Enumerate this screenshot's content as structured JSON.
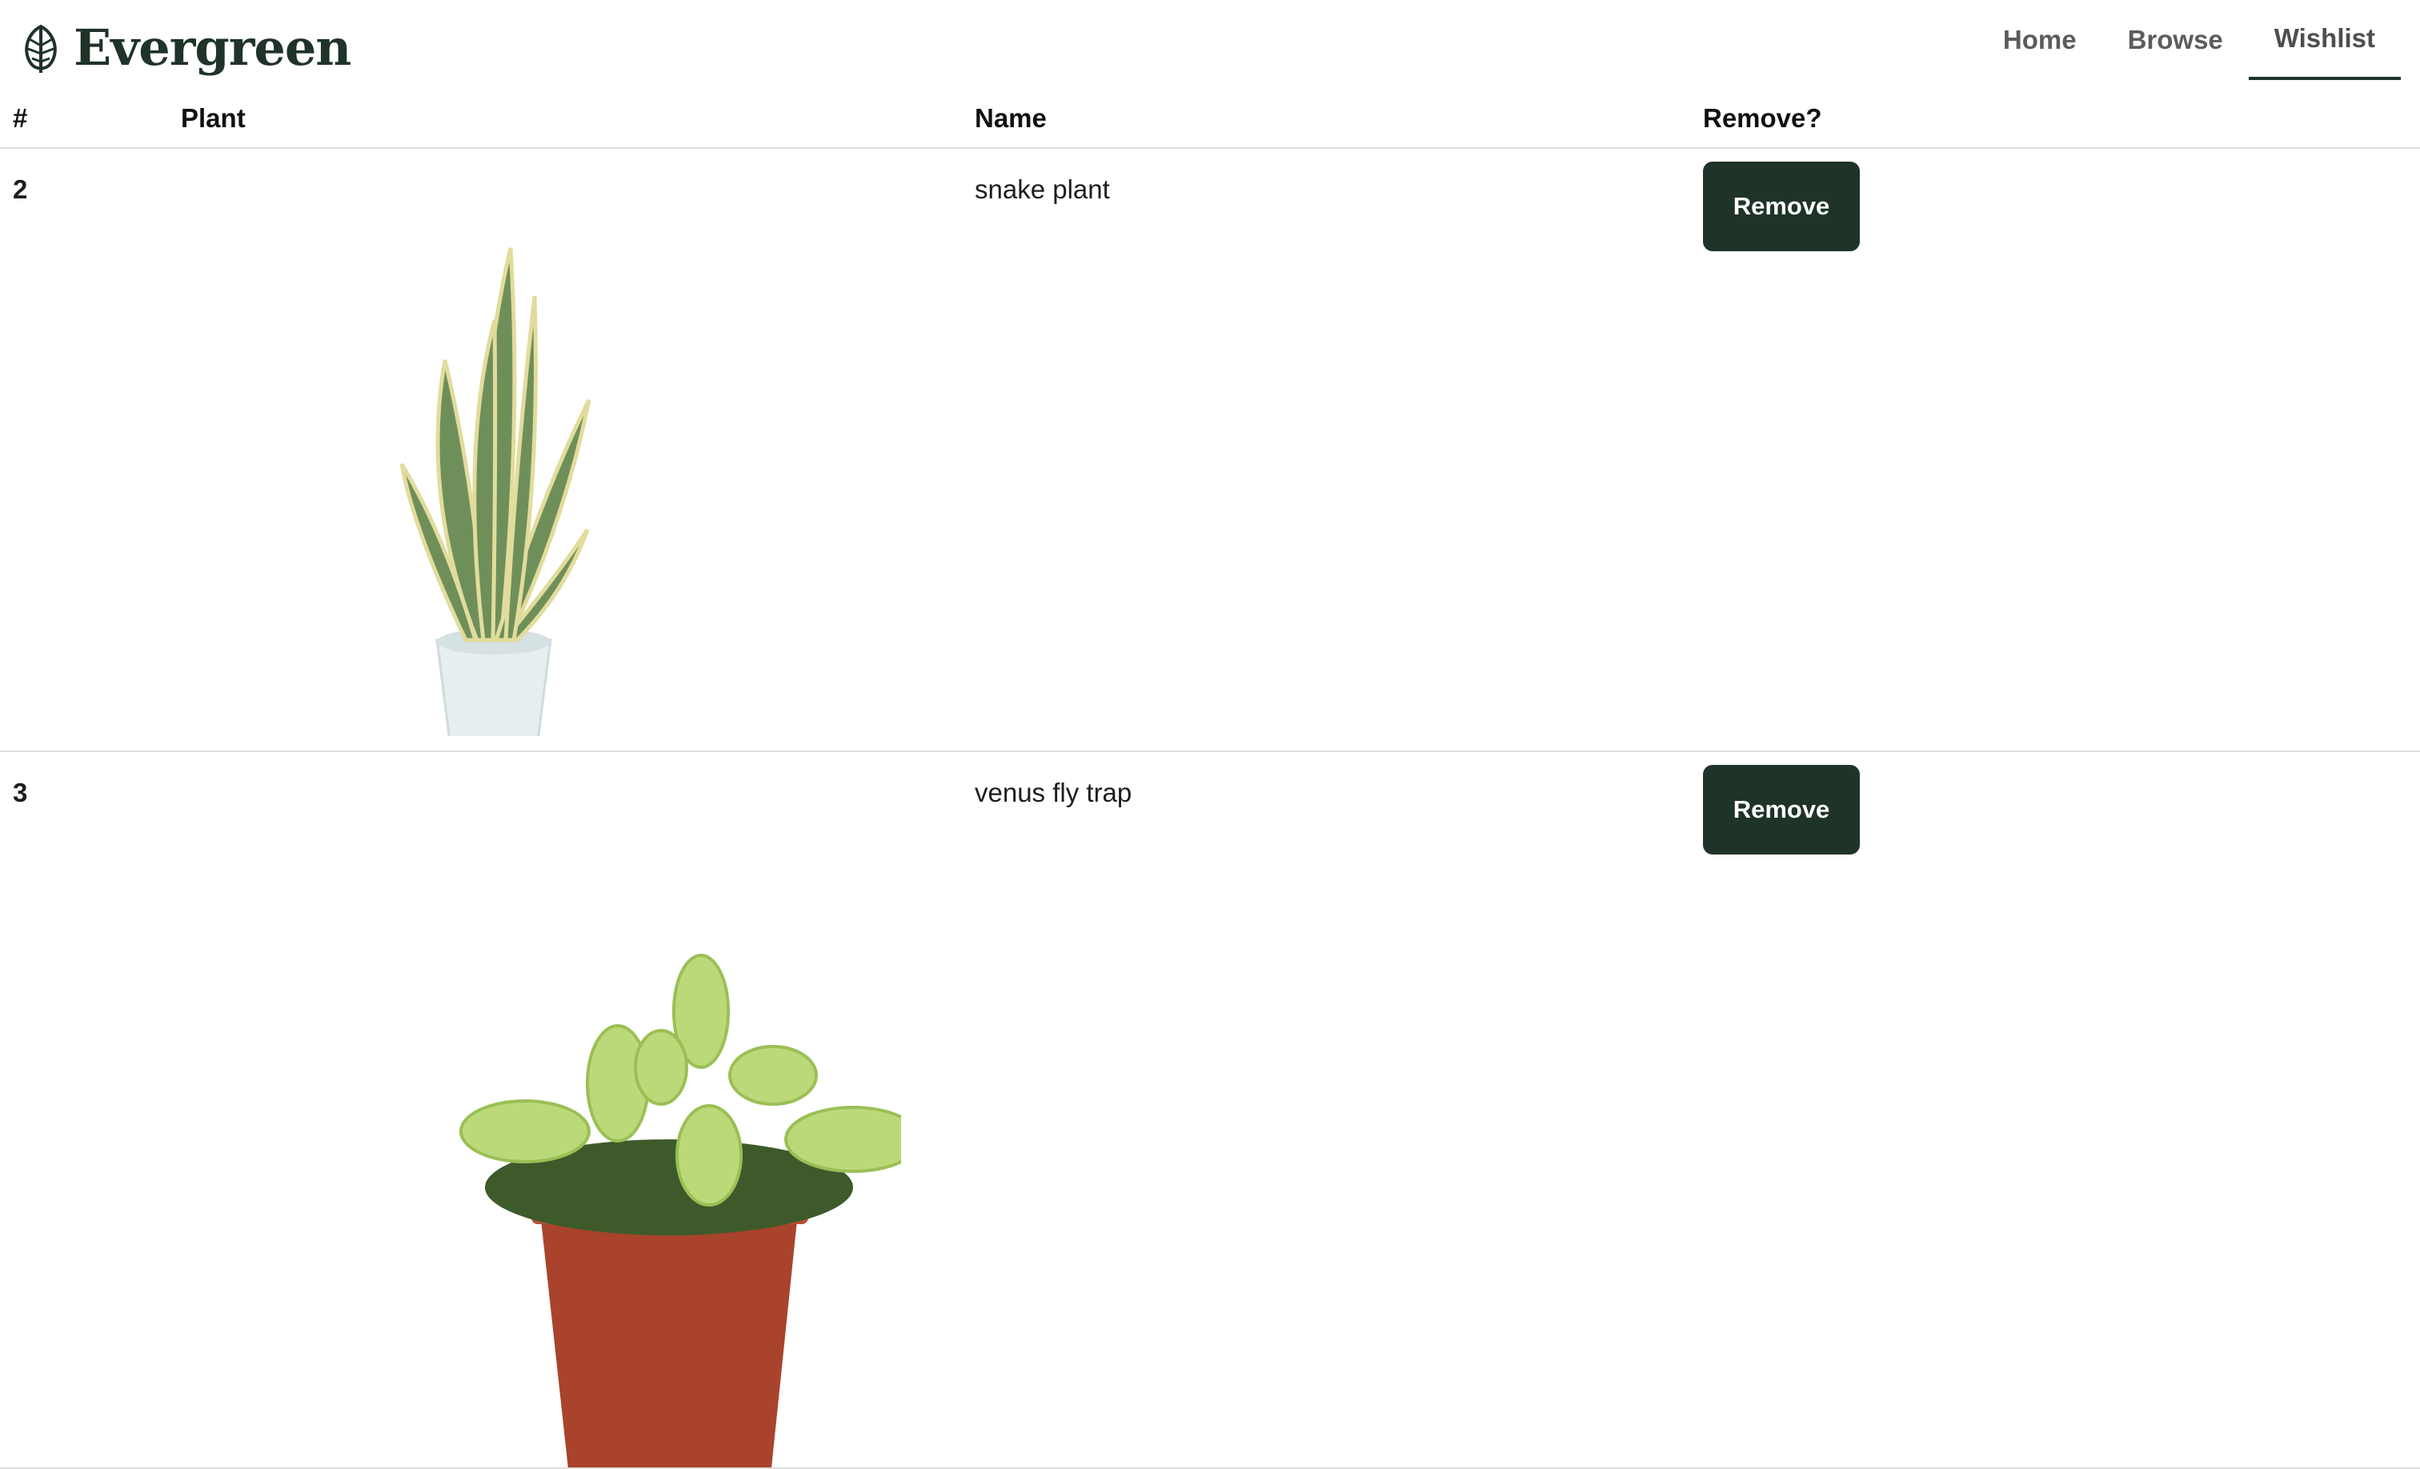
{
  "brand": {
    "name": "Evergreen",
    "logo_icon": "leaf-icon"
  },
  "nav": [
    {
      "label": "Home",
      "active": false
    },
    {
      "label": "Browse",
      "active": false
    },
    {
      "label": "Wishlist",
      "active": true
    }
  ],
  "table": {
    "headers": [
      "#",
      "Plant",
      "Name",
      "Remove?"
    ],
    "rows": [
      {
        "id": "2",
        "image": "snake-plant-image",
        "name": "snake plant",
        "button": "Remove"
      },
      {
        "id": "3",
        "image": "venus-fly-trap-image",
        "name": "venus fly trap",
        "button": "Remove"
      }
    ]
  },
  "colors": {
    "accent": "#1f3328",
    "nav_text": "#5c5c5c",
    "divider": "#dedede"
  }
}
